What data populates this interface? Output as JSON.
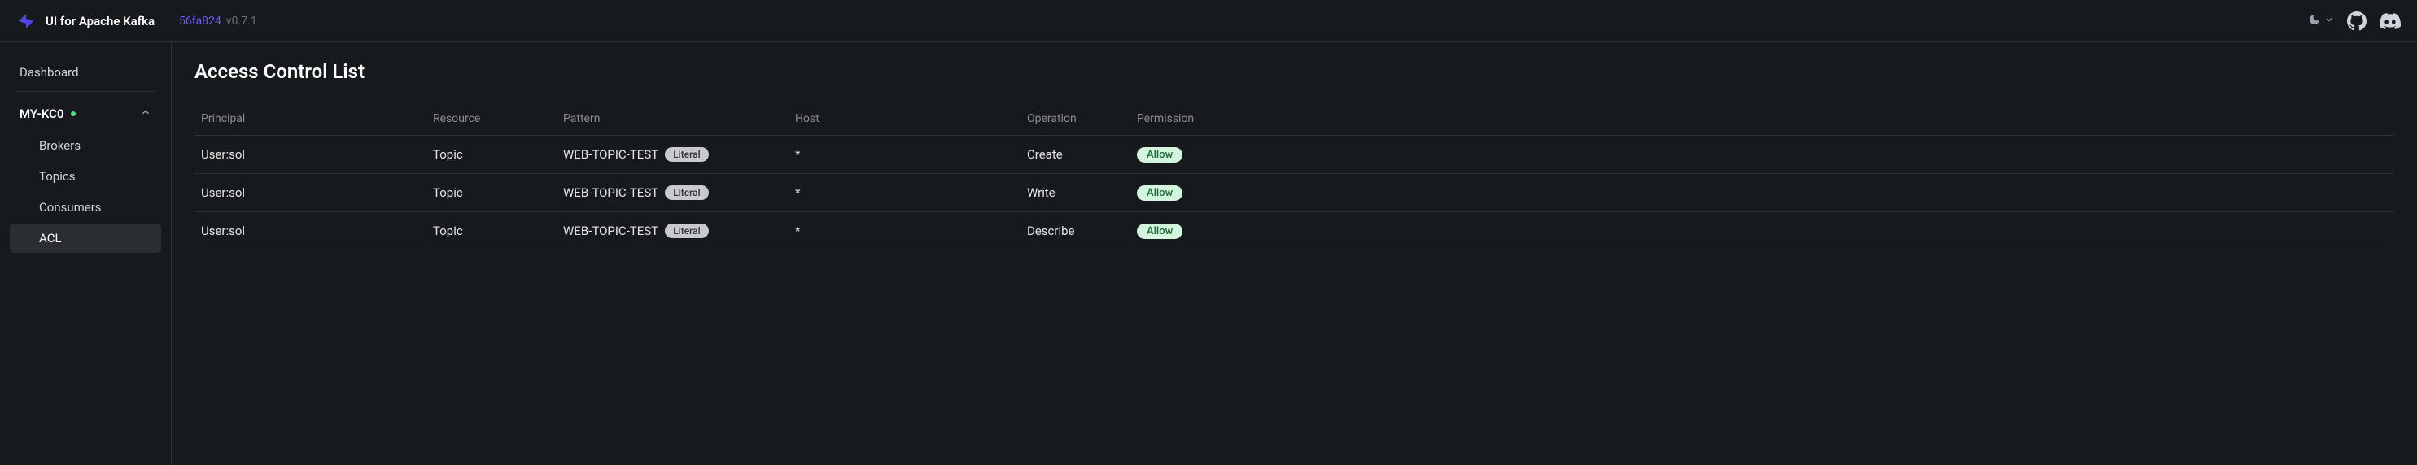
{
  "header": {
    "app_title": "UI for Apache Kafka",
    "commit_hash": "56fa824",
    "version": "v0.7.1"
  },
  "sidebar": {
    "dashboard_label": "Dashboard",
    "cluster_name": "MY-KC0",
    "items": [
      {
        "label": "Brokers"
      },
      {
        "label": "Topics"
      },
      {
        "label": "Consumers"
      },
      {
        "label": "ACL"
      }
    ]
  },
  "main": {
    "page_title": "Access Control List",
    "columns": {
      "principal": "Principal",
      "resource": "Resource",
      "pattern": "Pattern",
      "host": "Host",
      "operation": "Operation",
      "permission": "Permission"
    },
    "rows": [
      {
        "principal": "User:sol",
        "resource": "Topic",
        "pattern": "WEB-TOPIC-TEST",
        "pattern_type": "Literal",
        "host": "*",
        "operation": "Create",
        "permission": "Allow"
      },
      {
        "principal": "User:sol",
        "resource": "Topic",
        "pattern": "WEB-TOPIC-TEST",
        "pattern_type": "Literal",
        "host": "*",
        "operation": "Write",
        "permission": "Allow"
      },
      {
        "principal": "User:sol",
        "resource": "Topic",
        "pattern": "WEB-TOPIC-TEST",
        "pattern_type": "Literal",
        "host": "*",
        "operation": "Describe",
        "permission": "Allow"
      }
    ]
  }
}
